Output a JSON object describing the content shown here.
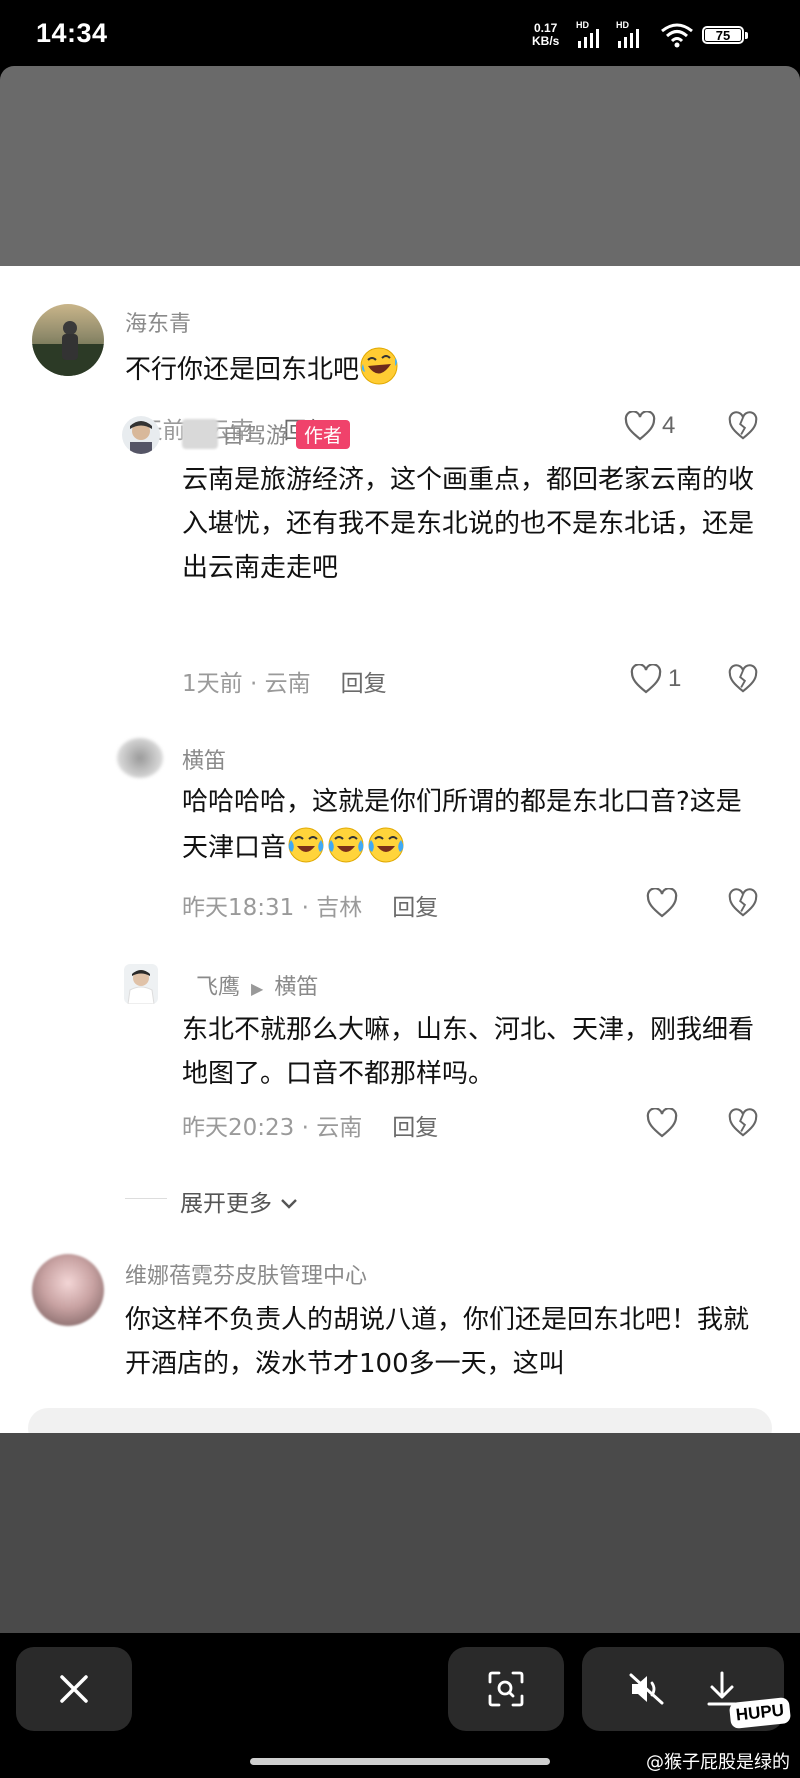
{
  "status_bar": {
    "time": "14:34",
    "net_speed_value": "0.17",
    "net_speed_unit": "KB/s",
    "sim_label": "HD",
    "battery": "75"
  },
  "comments": [
    {
      "username": "海东青",
      "text": "不行你还是回东北吧",
      "emoji": "rofl-emoji",
      "time": "1天前",
      "location": "云南",
      "reply_label": "回复",
      "likes": "4"
    },
    {
      "username": "自驾游",
      "username_visible": "自驾游",
      "author_tag": "作者",
      "text": "云南是旅游经济，这个画重点，都回老家云南的收入堪忧，还有我不是东北说的也不是东北话，还是出云南走走吧",
      "time": "1天前",
      "location": "云南",
      "reply_label": "回复",
      "likes": "1"
    },
    {
      "username": "横笛",
      "text": "哈哈哈哈，这就是你们所谓的都是东北口音?这是天津口音",
      "emoji": "crying-laughing-emoji",
      "time": "昨天18:31",
      "location": "吉林",
      "reply_label": "回复"
    },
    {
      "username": "飞鹰",
      "reply_to": "横笛",
      "text": "东北不就那么大嘛，山东、河北、天津，刚我细看地图了。口音不都那样吗。",
      "time": "昨天20:23",
      "location": "云南",
      "reply_label": "回复"
    },
    {
      "username": "维娜蓓霓芬皮肤管理中心",
      "text": "你这样不负责人的胡说八道，你们还是回东北吧！我就开酒店的，泼水节才100多一天，这叫"
    }
  ],
  "expand_label": "展开更多",
  "colors": {
    "author_tag": "#f0426b",
    "meta_text": "#9a9a9a",
    "panel_bg": "#ffffff"
  },
  "watermark": {
    "logo": "HUPU",
    "text": "@猴子屁股是绿的"
  },
  "bottom_buttons": [
    "close-icon",
    "scan-icon",
    "mute-icon",
    "download-icon"
  ]
}
